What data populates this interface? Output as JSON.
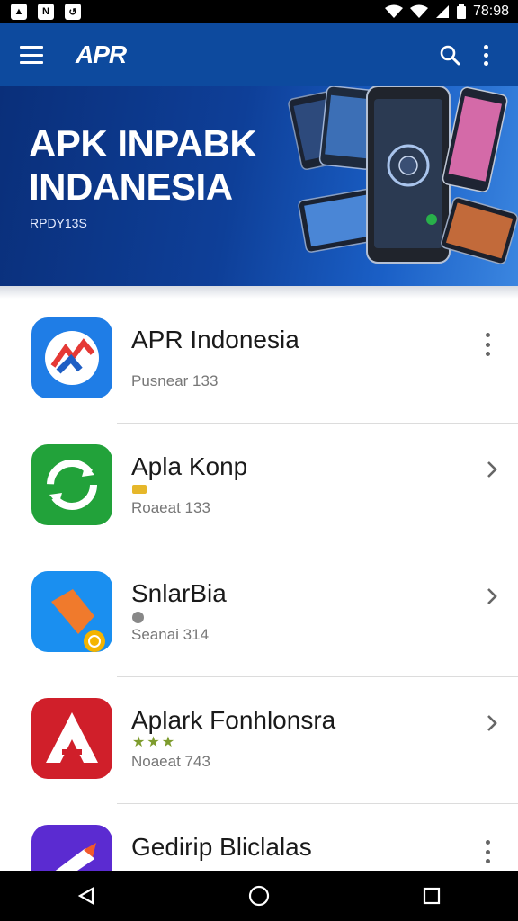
{
  "status_bar": {
    "time": "78:98"
  },
  "app_bar": {
    "brand": "APR"
  },
  "banner": {
    "title_line1": "APK INPABK",
    "title_line2": "INDANESIA",
    "subtitle": "RPDY13S"
  },
  "apps": [
    {
      "name": "APR Indonesia",
      "meta": "Pusnear 133",
      "action": "more"
    },
    {
      "name": "Apla Konp",
      "meta": "Roaeat 133",
      "action": "chevron"
    },
    {
      "name": "SnlarBia",
      "meta": "Seanai 314",
      "action": "chevron"
    },
    {
      "name": "Aplark Fonhlonsra",
      "meta": "Noaeat 743",
      "stars": "★★★",
      "action": "chevron"
    },
    {
      "name": "Gedirip Bliclalas",
      "meta": "",
      "action": "more"
    }
  ],
  "colors": {
    "app_bar": "#0d4a9e",
    "banner": "#0e3f98",
    "text": "#1a1a1a"
  }
}
